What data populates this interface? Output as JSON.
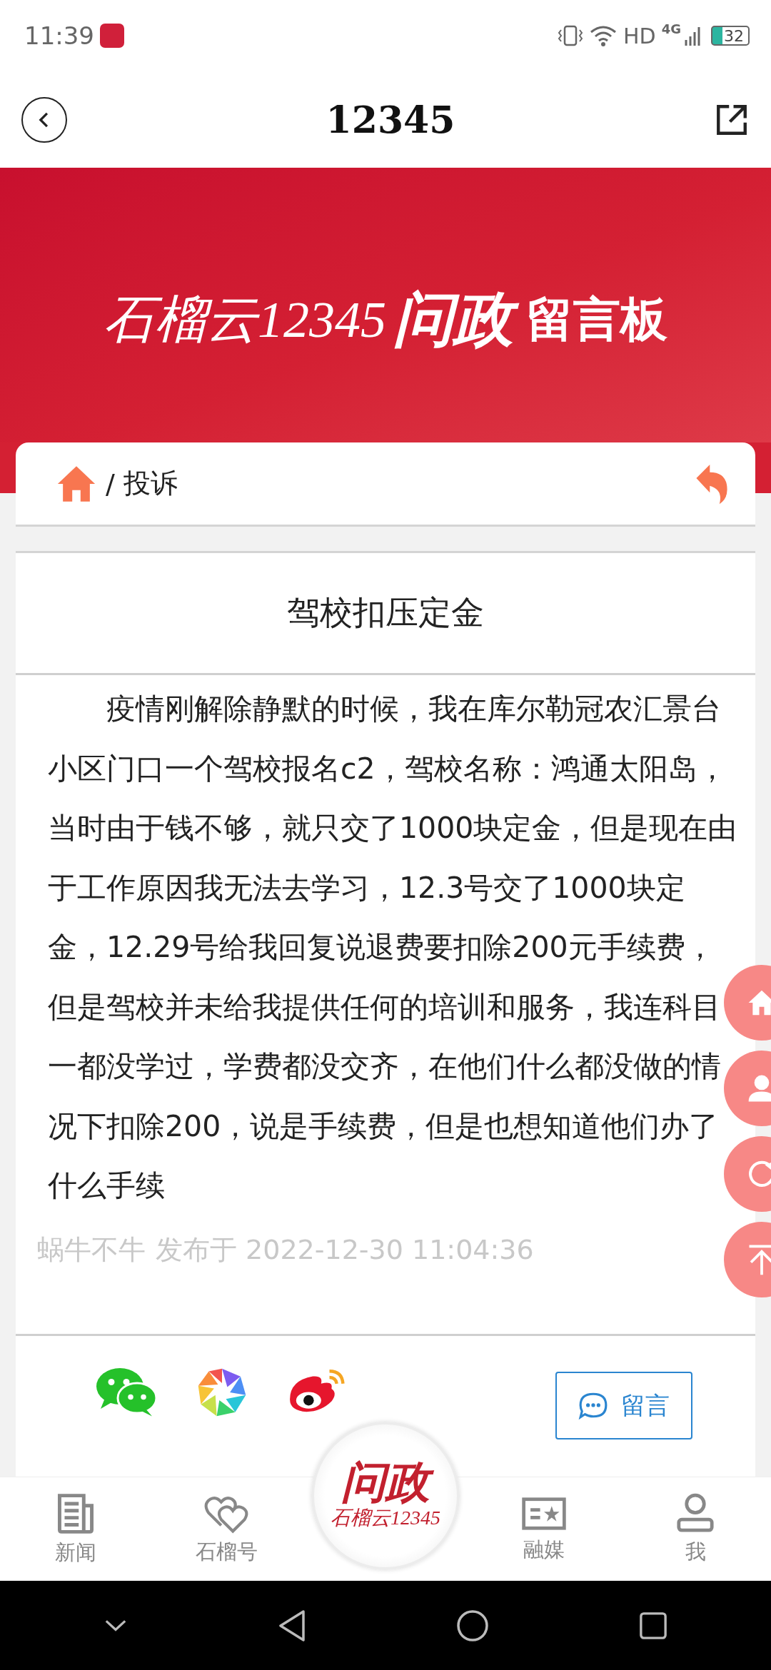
{
  "status_bar": {
    "time": "11:39",
    "network": "HD",
    "network_type": "4G",
    "battery": "32"
  },
  "header": {
    "title": "12345"
  },
  "banner": {
    "brand": "石榴云12345",
    "title_main": "问政",
    "title_rest": "留言板"
  },
  "breadcrumb": {
    "separator": "/",
    "current": "投诉"
  },
  "article": {
    "title": "驾校扣压定金",
    "body": "疫情刚解除静默的时候，我在库尔勒冠农汇景台小区门口一个驾校报名c2，驾校名称：鸿通太阳岛，当时由于钱不够，就只交了1000块定金，但是现在由于工作原因我无法去学习，12.3号交了1000块定金，12.29号给我回复说退费要扣除200元手续费，但是驾校并未给我提供任何的培训和服务，我连科目一都没学过，学费都没交齐，在他们什么都没做的情况下扣除200，说是手续费，但是也想知道他们办了什么手续",
    "author": "蜗牛不牛",
    "published": "发布于 2022-12-30 11:04:36"
  },
  "share": {
    "comment_button": "留言"
  },
  "floating_buttons": [
    {
      "kind": "home"
    },
    {
      "kind": "user"
    },
    {
      "kind": "refresh"
    },
    {
      "kind": "top"
    }
  ],
  "tab_bar": [
    {
      "label": "新闻",
      "kind": "news",
      "selected": false
    },
    {
      "label": "石榴号",
      "kind": "hearts",
      "selected": false
    },
    {
      "kind": "center",
      "title": "问政",
      "brand": "石榴云12345"
    },
    {
      "label": "融媒",
      "kind": "media",
      "selected": false
    },
    {
      "label": "我",
      "kind": "me",
      "selected": false
    }
  ]
}
